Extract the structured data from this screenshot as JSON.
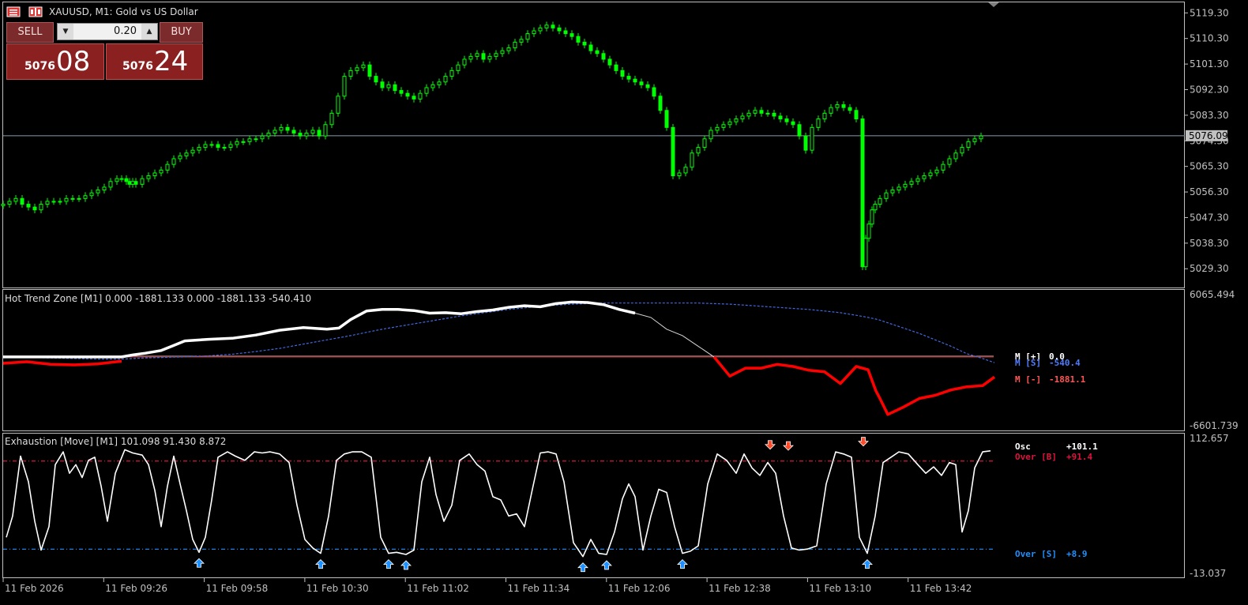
{
  "window": {
    "title": "XAUUSD, M1:  Gold vs US Dollar"
  },
  "trade_panel": {
    "sell_label": "SELL",
    "buy_label": "BUY",
    "lot": "0.20",
    "bid_prefix": "5076",
    "bid_big": "08",
    "ask_prefix": "5076",
    "ask_big": "24"
  },
  "colors": {
    "bull_candle": "#00ff00",
    "background": "#000000",
    "axis": "#c0c0c0",
    "trend_plus": "#ffffff",
    "trend_minus": "#ff0000",
    "trend_signal": "#4169e1",
    "osc_line": "#ffffff",
    "over_bought": "#dc143c",
    "over_sold": "#1e90ff",
    "sell_panel": "#8a2020"
  },
  "chart_data": [
    {
      "type": "candlestick",
      "title": "XAUUSD, M1:  Gold vs US Dollar",
      "y_ticks": [
        "5119.30",
        "5110.30",
        "5101.30",
        "5092.30",
        "5083.30",
        "5074.30",
        "5065.30",
        "5056.30",
        "5047.30",
        "5038.30",
        "5029.30"
      ],
      "ylim": [
        5022.7,
        5123.0
      ],
      "current_price_label": "5076.09",
      "current_price": 5076.09,
      "x_tick_labels": [
        "11 Feb 2026",
        "11 Feb 09:26",
        "11 Feb 09:58",
        "11 Feb 10:30",
        "11 Feb 11:02",
        "11 Feb 11:34",
        "11 Feb 12:06",
        "11 Feb 12:38",
        "11 Feb 13:10",
        "11 Feb 13:42"
      ],
      "x": [
        0,
        8,
        16,
        24,
        32,
        40,
        48,
        56,
        64,
        72,
        80,
        88,
        96,
        104,
        112,
        120,
        128,
        136,
        144,
        150,
        156,
        160,
        164,
        168,
        176,
        184,
        192,
        200,
        208,
        216,
        224,
        232,
        240,
        248,
        256,
        264,
        272,
        280,
        288,
        296,
        304,
        312,
        320,
        328,
        336,
        344,
        352,
        360,
        368,
        376,
        384,
        392,
        400,
        408,
        416,
        424,
        432,
        440,
        448,
        456,
        464,
        472,
        480,
        488,
        496,
        504,
        512,
        520,
        528,
        536,
        544,
        552,
        560,
        568,
        576,
        584,
        592,
        600,
        608,
        616,
        624,
        632,
        640,
        648,
        656,
        664,
        672,
        680,
        688,
        696,
        704,
        712,
        720,
        728,
        736,
        744,
        752,
        760,
        768,
        776,
        784,
        792,
        800,
        808,
        816,
        824,
        832,
        840,
        848,
        856,
        864,
        872,
        880,
        888,
        896,
        904,
        912,
        920,
        928,
        936,
        944,
        952,
        960,
        968,
        976,
        984,
        992,
        1000,
        1008,
        1016,
        1024,
        1032,
        1040,
        1048,
        1056,
        1064,
        1072,
        1080,
        1088,
        1092,
        1096,
        1100,
        1104,
        1110,
        1118,
        1126,
        1134,
        1142,
        1150,
        1158,
        1166,
        1174,
        1182,
        1190,
        1198,
        1206,
        1214,
        1222,
        1230,
        1238,
        1246,
        1254
      ],
      "close": [
        5052,
        5053,
        5054,
        5052,
        5051,
        5050,
        5052,
        5053,
        5053,
        5053,
        5054,
        5054,
        5054,
        5055,
        5056,
        5057,
        5058,
        5060,
        5061,
        5061,
        5060,
        5059,
        5060,
        5059,
        5061,
        5062,
        5063,
        5064,
        5066,
        5068,
        5069,
        5070,
        5071,
        5072,
        5073,
        5073,
        5072,
        5072,
        5073,
        5074,
        5074,
        5075,
        5075,
        5076,
        5077,
        5078,
        5079,
        5078,
        5077,
        5076,
        5077,
        5078,
        5076,
        5080,
        5084,
        5090,
        5097,
        5099,
        5100,
        5101,
        5097,
        5095,
        5093,
        5094,
        5092,
        5091,
        5090,
        5089,
        5091,
        5093,
        5094,
        5095,
        5097,
        5099,
        5101,
        5103,
        5104,
        5105,
        5103,
        5104,
        5105,
        5106,
        5107,
        5109,
        5110,
        5112,
        5113,
        5114,
        5115,
        5114,
        5113,
        5112,
        5111,
        5109,
        5108,
        5106,
        5105,
        5103,
        5101,
        5099,
        5097,
        5096,
        5095,
        5094,
        5093,
        5090,
        5085,
        5079,
        5062,
        5063,
        5065,
        5070,
        5072,
        5075,
        5078,
        5079,
        5080,
        5081,
        5082,
        5083,
        5084,
        5085,
        5084,
        5084,
        5083,
        5082,
        5081,
        5080,
        5076,
        5071,
        5079,
        5082,
        5084,
        5086,
        5087,
        5086,
        5085,
        5082,
        5030,
        5040,
        5045,
        5050,
        5052,
        5054,
        5056,
        5057,
        5058,
        5059,
        5060,
        5061,
        5062,
        5063,
        5064,
        5066,
        5068,
        5070,
        5072,
        5074,
        5075,
        5076
      ]
    },
    {
      "type": "line",
      "title": "Hot Trend Zone [M1] 0.000 -1881.133 0.000 -1881.133 -540.410",
      "y_ticks": [
        "6065.494",
        "-6601.739"
      ],
      "ylim": [
        -6601.739,
        6065.494
      ],
      "series": [
        {
          "name": "M [+]",
          "value_label": "0.0"
        },
        {
          "name": "M [S]",
          "value_label": "-540.4"
        },
        {
          "name": "M [-]",
          "value_label": "-1881.1"
        }
      ],
      "x": [
        0,
        30,
        60,
        90,
        120,
        150,
        165,
        180,
        200,
        215,
        230,
        260,
        290,
        320,
        350,
        380,
        410,
        425,
        440,
        460,
        480,
        500,
        520,
        540,
        560,
        580,
        600,
        620,
        640,
        660,
        680,
        700,
        720,
        740,
        760,
        780,
        800,
        820,
        840,
        860,
        880,
        900,
        920,
        940,
        960,
        980,
        1000,
        1020,
        1040,
        1060,
        1080,
        1095,
        1105,
        1110,
        1120,
        1140,
        1160,
        1180,
        1200,
        1220,
        1240,
        1255
      ],
      "plus": [
        0,
        0,
        0,
        0,
        0,
        0,
        200,
        350,
        600,
        1050,
        1500,
        1650,
        1750,
        2050,
        2500,
        2750,
        2600,
        2700,
        3500,
        4300,
        4450,
        4450,
        4350,
        4100,
        4150,
        4050,
        4250,
        4400,
        4650,
        4800,
        4700,
        5000,
        5150,
        5100,
        4900,
        4450,
        4100,
        null,
        null,
        null,
        null,
        null,
        null,
        null,
        null,
        null,
        null,
        null,
        null,
        null,
        null,
        null,
        null,
        null,
        null,
        null,
        null,
        null,
        null,
        null,
        null,
        null
      ],
      "thin": [
        null,
        null,
        null,
        null,
        null,
        null,
        null,
        null,
        null,
        null,
        null,
        null,
        null,
        null,
        null,
        null,
        null,
        null,
        null,
        null,
        null,
        null,
        null,
        null,
        null,
        null,
        null,
        null,
        null,
        null,
        null,
        null,
        null,
        null,
        null,
        null,
        4100,
        3700,
        2600,
        2000,
        1000,
        0,
        null,
        null,
        null,
        null,
        null,
        null,
        null,
        null,
        null,
        null,
        null,
        null,
        null,
        null,
        null,
        null,
        null,
        null,
        null,
        null
      ],
      "minus": [
        -600,
        -450,
        -700,
        -750,
        -650,
        -400,
        null,
        null,
        null,
        null,
        null,
        null,
        null,
        null,
        null,
        null,
        null,
        null,
        null,
        null,
        null,
        null,
        null,
        null,
        null,
        null,
        null,
        null,
        null,
        null,
        null,
        null,
        null,
        null,
        null,
        null,
        null,
        null,
        null,
        null,
        null,
        0,
        -1800,
        -1050,
        -1050,
        -700,
        -900,
        -1250,
        -1400,
        -2500,
        -900,
        -1200,
        -3200,
        -3900,
        -5400,
        -4700,
        -3900,
        -3600,
        -3100,
        -2800,
        -2700,
        -1881
      ],
      "signal": [
        0,
        -50,
        -100,
        -150,
        -200,
        -200,
        -150,
        -100,
        -50,
        -20,
        0,
        100,
        250,
        500,
        800,
        1200,
        1600,
        1800,
        2000,
        2300,
        2600,
        2850,
        3100,
        3350,
        3600,
        3850,
        4050,
        4250,
        4450,
        4600,
        4750,
        4850,
        4950,
        5000,
        5050,
        5050,
        5050,
        5050,
        5050,
        5050,
        5050,
        5000,
        4950,
        4850,
        4750,
        4650,
        4550,
        4450,
        4300,
        4150,
        3900,
        3700,
        3550,
        3450,
        3200,
        2700,
        2200,
        1600,
        1000,
        300,
        -150,
        -540
      ]
    },
    {
      "type": "line",
      "title": "Exhaustion [Move] [M1] 101.098 91.430 8.872",
      "y_ticks": [
        "112.657",
        "-13.037"
      ],
      "ylim": [
        -13.037,
        112.657
      ],
      "series": [
        {
          "name": "Osc",
          "value_label": "+101.1"
        },
        {
          "name": "Over [B]",
          "value_label": "+91.4"
        },
        {
          "name": "Over [S]",
          "value_label": "+8.9"
        }
      ],
      "over_b": 91.4,
      "over_s": 8.9,
      "x": [
        4,
        12,
        22,
        32,
        40,
        48,
        58,
        66,
        76,
        84,
        92,
        100,
        108,
        116,
        124,
        132,
        142,
        154,
        164,
        176,
        184,
        192,
        200,
        208,
        216,
        224,
        232,
        240,
        248,
        256,
        264,
        272,
        284,
        294,
        306,
        318,
        328,
        338,
        350,
        362,
        372,
        382,
        392,
        402,
        412,
        422,
        432,
        442,
        454,
        466,
        478,
        488,
        498,
        510,
        520,
        530,
        540,
        548,
        558,
        568,
        578,
        590,
        600,
        610,
        620,
        630,
        640,
        650,
        660,
        670,
        680,
        690,
        700,
        710,
        722,
        734,
        744,
        754,
        764,
        774,
        784,
        792,
        800,
        810,
        820,
        830,
        840,
        850,
        860,
        870,
        880,
        892,
        904,
        916,
        928,
        938,
        948,
        958,
        968,
        978,
        988,
        998,
        1008,
        1018,
        1030,
        1042,
        1054,
        1064,
        1074,
        1084,
        1094,
        1104,
        1114,
        1124,
        1134,
        1146,
        1158,
        1168,
        1178,
        1188,
        1198,
        1206,
        1214,
        1222,
        1230,
        1240,
        1250,
        1256
      ],
      "osc": [
        20,
        40,
        96,
        72,
        35,
        8,
        30,
        88,
        100,
        80,
        88,
        76,
        92,
        95,
        68,
        35,
        80,
        102,
        99,
        97,
        88,
        64,
        30,
        68,
        96,
        70,
        45,
        18,
        6,
        20,
        55,
        95,
        100,
        96,
        92,
        100,
        99,
        100,
        98,
        90,
        50,
        18,
        10,
        5,
        40,
        92,
        98,
        100,
        100,
        95,
        20,
        5,
        6,
        4,
        8,
        72,
        95,
        60,
        35,
        50,
        92,
        98,
        88,
        82,
        58,
        55,
        40,
        42,
        30,
        65,
        99,
        100,
        98,
        72,
        15,
        2,
        18,
        5,
        4,
        25,
        56,
        70,
        58,
        8,
        40,
        65,
        62,
        30,
        5,
        7,
        12,
        70,
        98,
        92,
        80,
        98,
        85,
        78,
        90,
        80,
        40,
        10,
        8,
        9,
        12,
        70,
        100,
        98,
        95,
        20,
        5,
        40,
        90,
        95,
        100,
        98,
        88,
        80,
        86,
        78,
        90,
        88,
        25,
        45,
        85,
        100,
        101
      ]
    }
  ]
}
